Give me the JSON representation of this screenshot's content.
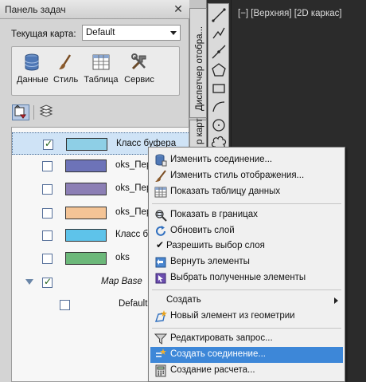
{
  "task_pane": {
    "title": "Панель задач",
    "close_glyph": "✕",
    "current_map_label": "Текущая карта:",
    "current_map_value": "Default",
    "tools": [
      {
        "label": "Данные",
        "icon": "database-icon"
      },
      {
        "label": "Стиль",
        "icon": "brush-icon"
      },
      {
        "label": "Таблица",
        "icon": "table-icon"
      },
      {
        "label": "Сервис",
        "icon": "tools-icon"
      }
    ],
    "layers": [
      {
        "name": "Класс буфера",
        "color": "#8ecfe6",
        "checked": true,
        "selected": true
      },
      {
        "name": "oks_Пер",
        "color": "#6d73b8",
        "checked": false
      },
      {
        "name": "oks_Пер",
        "color": "#8c7fb5",
        "checked": false
      },
      {
        "name": "oks_Пер",
        "color": "#f4c496",
        "checked": false
      },
      {
        "name": "Класс б",
        "color": "#5ec3ea",
        "checked": false
      },
      {
        "name": "oks",
        "color": "#6cb87a",
        "checked": false
      }
    ],
    "group": {
      "name": "Map Base",
      "checked": true
    },
    "group_child": {
      "name": "Default",
      "checked": false
    }
  },
  "side_tabs": {
    "display_manager": "Диспетчер отобра...",
    "map_explorer": "р карт"
  },
  "viewport": {
    "label": "[−] [Верхняя] [2D каркас]"
  },
  "context_menu": {
    "items": [
      {
        "label": "Изменить соединение...",
        "icon": "database-connect-icon"
      },
      {
        "label": "Изменить стиль отображения...",
        "icon": "brush-icon"
      },
      {
        "label": "Показать таблицу данных",
        "icon": "table-icon"
      },
      {
        "label": "Показать в границах",
        "icon": "zoom-extents-icon"
      },
      {
        "label": "Обновить слой",
        "icon": "refresh-icon"
      },
      {
        "label": "Разрешить выбор слоя",
        "icon": "checkmark-icon"
      },
      {
        "label": "Вернуть элементы",
        "icon": "return-features-icon"
      },
      {
        "label": "Выбрать полученные элементы",
        "icon": "select-features-icon"
      },
      {
        "label": "Создать",
        "icon": "none"
      },
      {
        "label": "Новый элемент из геометрии",
        "icon": "new-feature-icon"
      },
      {
        "label": "Редактировать запрос...",
        "icon": "filter-icon"
      },
      {
        "label": "Создать соединение...",
        "icon": "join-icon"
      },
      {
        "label": "Создание расчета...",
        "icon": "calculator-icon"
      }
    ],
    "highlight_color": "#3d87d8"
  }
}
